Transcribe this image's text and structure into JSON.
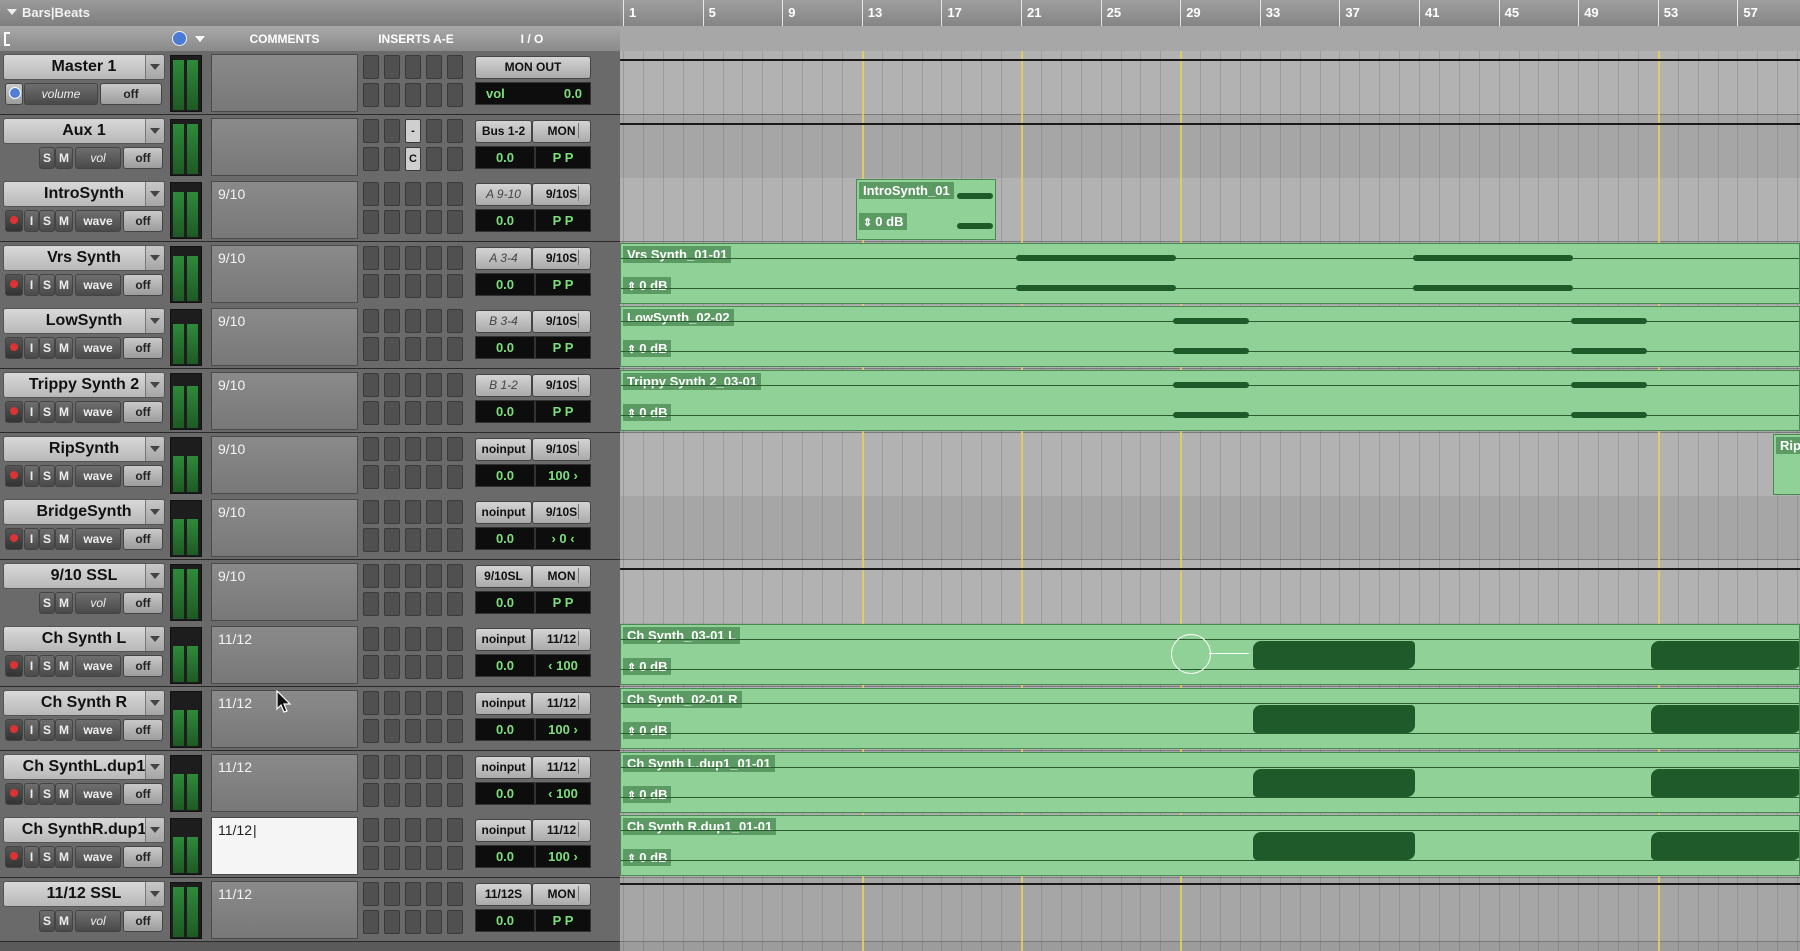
{
  "header": {
    "ruler_mode": "Bars|Beats"
  },
  "columns": {
    "comments": "COMMENTS",
    "inserts": "INSERTS A-E",
    "io": "I / O"
  },
  "ruler": {
    "bars": [
      "1",
      "5",
      "9",
      "13",
      "17",
      "21",
      "25",
      "29",
      "33",
      "37",
      "41",
      "45",
      "49",
      "53",
      "57"
    ]
  },
  "tracks": [
    {
      "name": "Master 1",
      "view": "volume",
      "auto": "off",
      "comment": "",
      "in": "MON OUT",
      "out": "",
      "vol_label": "vol",
      "vol": "0.0",
      "pan": ""
    },
    {
      "name": "Aux 1",
      "s": "S",
      "m": "M",
      "view": "vol",
      "auto": "off",
      "comment": "",
      "in": "Bus 1-2",
      "out": "MON",
      "vol": "0.0",
      "pan": "P P",
      "insert_mark_1": "-",
      "insert_mark_2": "C"
    },
    {
      "name": "IntroSynth",
      "i": "I",
      "s": "S",
      "m": "M",
      "view": "wave",
      "auto": "off",
      "comment": "9/10",
      "in": "A 9-10",
      "out": "9/10S",
      "vol": "0.0",
      "pan": "P P"
    },
    {
      "name": "Vrs Synth",
      "i": "I",
      "s": "S",
      "m": "M",
      "view": "wave",
      "auto": "off",
      "comment": "9/10",
      "in": "A 3-4",
      "out": "9/10S",
      "vol": "0.0",
      "pan": "P P"
    },
    {
      "name": "LowSynth",
      "i": "I",
      "s": "S",
      "m": "M",
      "view": "wave",
      "auto": "off",
      "comment": "9/10",
      "in": "B 3-4",
      "out": "9/10S",
      "vol": "0.0",
      "pan": "P P"
    },
    {
      "name": "Trippy Synth 2",
      "i": "I",
      "s": "S",
      "m": "M",
      "view": "wave",
      "auto": "off",
      "comment": "9/10",
      "in": "B 1-2",
      "out": "9/10S",
      "vol": "0.0",
      "pan": "P P"
    },
    {
      "name": "RipSynth",
      "i": "I",
      "s": "S",
      "m": "M",
      "view": "wave",
      "auto": "off",
      "comment": "9/10",
      "in": "noinput",
      "out": "9/10S",
      "vol": "0.0",
      "pan": "100 ›"
    },
    {
      "name": "BridgeSynth",
      "i": "I",
      "s": "S",
      "m": "M",
      "view": "wave",
      "auto": "off",
      "comment": "9/10",
      "in": "noinput",
      "out": "9/10S",
      "vol": "0.0",
      "pan": "› 0 ‹"
    },
    {
      "name": "9/10 SSL",
      "s": "S",
      "m": "M",
      "view": "vol",
      "auto": "off",
      "comment": "9/10",
      "in": "9/10SL",
      "out": "MON",
      "vol": "0.0",
      "pan": "P P"
    },
    {
      "name": "Ch Synth L",
      "i": "I",
      "s": "S",
      "m": "M",
      "view": "wave",
      "auto": "off",
      "comment": "11/12",
      "in": "noinput",
      "out": "11/12",
      "vol": "0.0",
      "pan": "‹ 100"
    },
    {
      "name": "Ch Synth R",
      "i": "I",
      "s": "S",
      "m": "M",
      "view": "wave",
      "auto": "off",
      "comment": "11/12",
      "in": "noinput",
      "out": "11/12",
      "vol": "0.0",
      "pan": "100 ›"
    },
    {
      "name": "Ch SynthL.dup1",
      "i": "I",
      "s": "S",
      "m": "M",
      "view": "wave",
      "auto": "off",
      "comment": "11/12",
      "in": "noinput",
      "out": "11/12",
      "vol": "0.0",
      "pan": "‹ 100"
    },
    {
      "name": "Ch SynthR.dup1",
      "i": "I",
      "s": "S",
      "m": "M",
      "view": "wave",
      "auto": "off",
      "comment": "11/12",
      "in": "noinput",
      "out": "11/12",
      "vol": "0.0",
      "pan": "100 ›"
    },
    {
      "name": "11/12 SSL",
      "s": "S",
      "m": "M",
      "view": "vol",
      "auto": "off",
      "comment": "11/12",
      "in": "11/12S",
      "out": "MON",
      "vol": "0.0",
      "pan": "P P"
    }
  ],
  "clips": [
    {
      "name": "IntroSynth_01",
      "gain": "0 dB"
    },
    {
      "name": "Vrs Synth_01-01",
      "gain": "0 dB"
    },
    {
      "name": "LowSynth_02-02",
      "gain": "0 dB"
    },
    {
      "name": "Trippy Synth 2_03-01",
      "gain": "0 dB"
    },
    {
      "name": "Rip"
    },
    {
      "name": "Ch Synth_03-01 L",
      "gain": "0 dB"
    },
    {
      "name": "Ch Synth_02-01 R",
      "gain": "0 dB"
    },
    {
      "name": "Ch Synth L.dup1_01-01",
      "gain": "0 dB"
    },
    {
      "name": "Ch Synth R.dup1_01-01",
      "gain": "0 dB"
    }
  ]
}
